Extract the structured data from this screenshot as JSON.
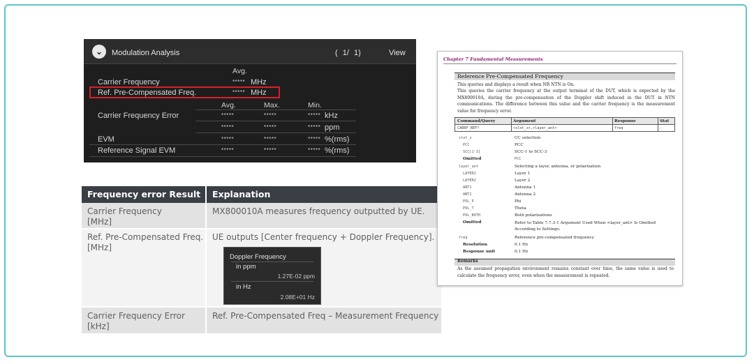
{
  "modulation_panel": {
    "title": "Modulation Analysis",
    "page_open": "(",
    "page_indicator": "1/",
    "page_total": "1)",
    "view_label": "View",
    "avg_header": "Avg.",
    "carrier_frequency": {
      "label": "Carrier Frequency",
      "value": "*****",
      "unit": "MHz"
    },
    "ref_precomp": {
      "label": "Ref. Pre-Compensated Freq.",
      "value": "*****",
      "unit": "MHz"
    },
    "col_headers": {
      "avg": "Avg.",
      "max": "Max.",
      "min": "Min."
    },
    "rows": [
      {
        "label": "Carrier Frequency Error",
        "avg": "*****",
        "max": "*****",
        "min": "*****",
        "unit": "kHz"
      },
      {
        "label": "",
        "avg": "*****",
        "max": "*****",
        "min": "*****",
        "unit": "ppm"
      },
      {
        "label": "EVM",
        "avg": "*****",
        "max": "*****",
        "min": "*****",
        "unit": "%(rms)"
      },
      {
        "label": "Reference Signal EVM",
        "avg": "*****",
        "max": "*****",
        "min": "*****",
        "unit": "%(rms)"
      }
    ],
    "highlight_color": "#d8202a"
  },
  "results_table": {
    "headers": [
      "Frequency error Result",
      "Explanation"
    ],
    "rows": [
      {
        "result": "Carrier Frequency [MHz]",
        "explanation": "MX800010A measures frequency outputted by UE."
      },
      {
        "result": "Ref. Pre-Compensated Freq. [MHz]",
        "explanation": "UE outputs [Center frequency + Doppler Frequency]."
      },
      {
        "result": "Carrier Frequency Error [kHz]",
        "explanation": "Ref. Pre-Compensated Freq – Measurement Frequency"
      }
    ],
    "doppler_inset": {
      "title": "Doppler Frequency",
      "ppm_label": "in ppm",
      "ppm_value": "1.27E-02 ppm",
      "hz_label": "in Hz",
      "hz_value": "2.08E+01 Hz"
    }
  },
  "doc_page": {
    "chapter": "Chapter 7   Fundamental Measurements",
    "section_title": "Reference Pre-Compensated Frequency",
    "para1": "This queries and displays a result when NR NTN is On.",
    "para2": "This queries the carrier frequency at the output terminal of the DUT, which is expected by the MX800010A, during the pre-compensation of the Doppler shift induced in the DUT in NTN communications. The difference between this value and the carrier frequency is the measurement value for frequency error.",
    "cmd_headers": [
      "Command/Query",
      "Argument",
      "Response",
      "Stat"
    ],
    "cmd_row": [
      "CARRF_REF?",
      "<slot_x>,<layer_ant>",
      "freq",
      "-"
    ],
    "params": [
      {
        "name": "slot_x",
        "desc": "CC selection"
      },
      {
        "name": "PCC",
        "desc": "PCC"
      },
      {
        "name": "SCC[1-3]",
        "desc": "SCC-1 to SCC-3"
      },
      {
        "name": "Omitted",
        "desc": "PCC"
      },
      {
        "name": "layer_ant",
        "desc": "Selecting a layer, antenna, or polarization"
      },
      {
        "name": "LAYER1",
        "desc": "Layer 1"
      },
      {
        "name": "LAYER2",
        "desc": "Layer 2"
      },
      {
        "name": "ANT1",
        "desc": "Antenna 1"
      },
      {
        "name": "ANT2",
        "desc": "Antenna 2"
      },
      {
        "name": "POL_P",
        "desc": "Phi"
      },
      {
        "name": "POL_T",
        "desc": "Theta"
      },
      {
        "name": "POL_BOTH",
        "desc": "Both polarizations"
      },
      {
        "name": "Omitted",
        "desc": "Refer to Table 7.7.3-1   Argument Used When <layer_ant> Is Omitted According to Settings."
      },
      {
        "name": "freq",
        "desc": "Reference pre-compensated frequency"
      },
      {
        "name": "Resolution",
        "desc": "0.1 Hz"
      },
      {
        "name": "Response unit",
        "desc": "0.1 Hz"
      }
    ],
    "remarks_title": "Remarks",
    "remarks_text": "As the assumed propagation environment remains constant over time, the same value is used to calculate the frequency error, even when the measurement is repeated."
  }
}
